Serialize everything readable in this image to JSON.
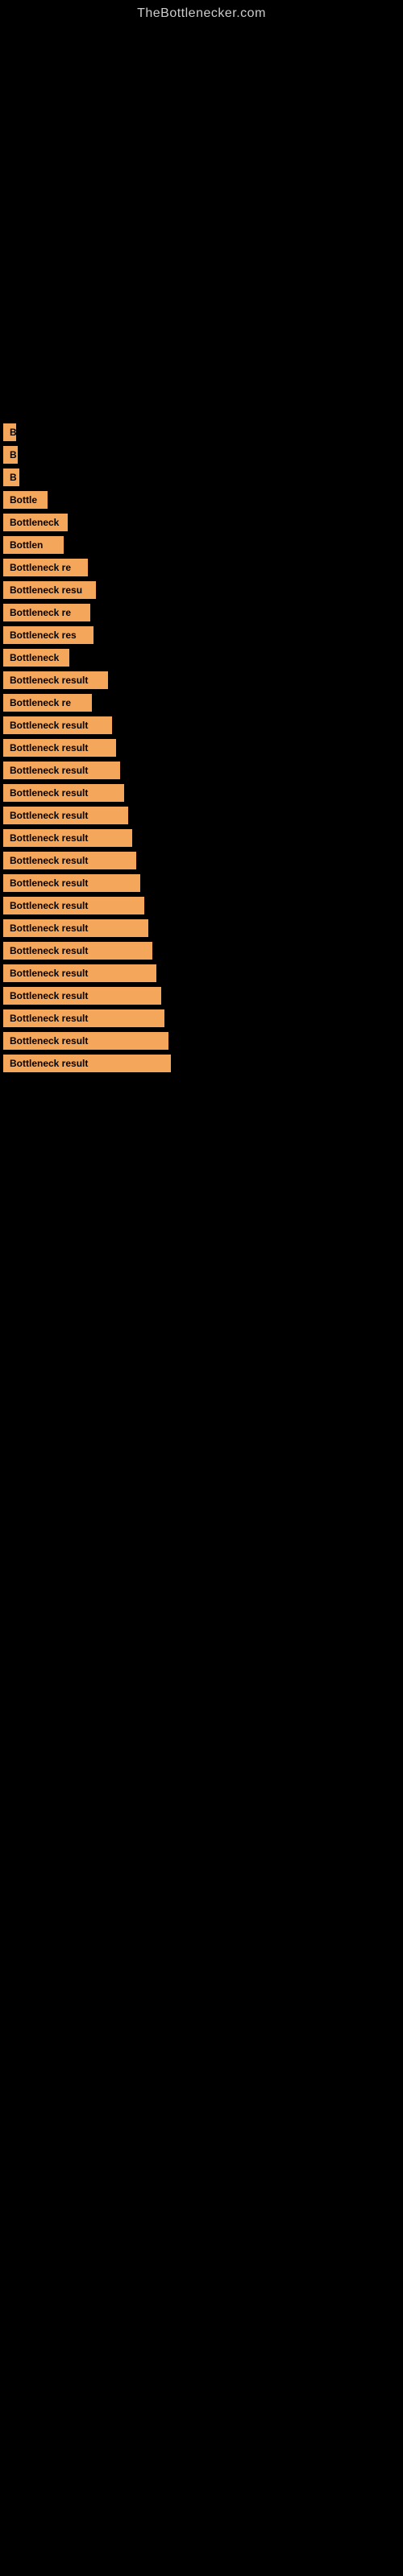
{
  "site": {
    "title": "TheBottlenecker.com"
  },
  "results": [
    {
      "id": 1,
      "label": "B",
      "width_class": "w-16"
    },
    {
      "id": 2,
      "label": "B",
      "width_class": "w-18"
    },
    {
      "id": 3,
      "label": "B",
      "width_class": "w-20"
    },
    {
      "id": 4,
      "label": "Bottle",
      "width_class": "w-55"
    },
    {
      "id": 5,
      "label": "Bottleneck",
      "width_class": "w-80"
    },
    {
      "id": 6,
      "label": "Bottlen",
      "width_class": "w-75"
    },
    {
      "id": 7,
      "label": "Bottleneck re",
      "width_class": "w-105"
    },
    {
      "id": 8,
      "label": "Bottleneck resu",
      "width_class": "w-115"
    },
    {
      "id": 9,
      "label": "Bottleneck re",
      "width_class": "w-108"
    },
    {
      "id": 10,
      "label": "Bottleneck res",
      "width_class": "w-112"
    },
    {
      "id": 11,
      "label": "Bottleneck",
      "width_class": "w-82"
    },
    {
      "id": 12,
      "label": "Bottleneck result",
      "width_class": "w-130"
    },
    {
      "id": 13,
      "label": "Bottleneck re",
      "width_class": "w-110"
    },
    {
      "id": 14,
      "label": "Bottleneck result",
      "width_class": "w-135"
    },
    {
      "id": 15,
      "label": "Bottleneck result",
      "width_class": "w-140"
    },
    {
      "id": 16,
      "label": "Bottleneck result",
      "width_class": "w-145"
    },
    {
      "id": 17,
      "label": "Bottleneck result",
      "width_class": "w-150"
    },
    {
      "id": 18,
      "label": "Bottleneck result",
      "width_class": "w-155"
    },
    {
      "id": 19,
      "label": "Bottleneck result",
      "width_class": "w-160"
    },
    {
      "id": 20,
      "label": "Bottleneck result",
      "width_class": "w-165"
    },
    {
      "id": 21,
      "label": "Bottleneck result",
      "width_class": "w-170"
    },
    {
      "id": 22,
      "label": "Bottleneck result",
      "width_class": "w-175"
    },
    {
      "id": 23,
      "label": "Bottleneck result",
      "width_class": "w-180"
    },
    {
      "id": 24,
      "label": "Bottleneck result",
      "width_class": "w-185"
    },
    {
      "id": 25,
      "label": "Bottleneck result",
      "width_class": "w-190"
    },
    {
      "id": 26,
      "label": "Bottleneck result",
      "width_class": "w-196"
    },
    {
      "id": 27,
      "label": "Bottleneck result",
      "width_class": "w-200"
    },
    {
      "id": 28,
      "label": "Bottleneck result",
      "width_class": "w-205"
    },
    {
      "id": 29,
      "label": "Bottleneck result",
      "width_class": "w-208"
    }
  ]
}
